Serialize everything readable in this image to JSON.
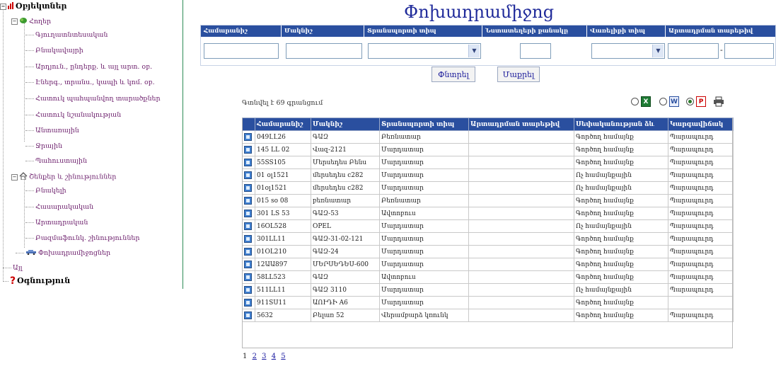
{
  "tree": {
    "root_label": "Օբյեկտներ",
    "nodes": [
      {
        "label": "Հողեր"
      },
      {
        "label": "Գյուղատնտեսական"
      },
      {
        "label": "Բնակավայրի"
      },
      {
        "label": "Արդյուն., ընդերք. և այլ արտ. օբ."
      },
      {
        "label": "Էներգ., տրանս., կապի և կոմ. օբ."
      },
      {
        "label": "Հատուկ պահպանվող տարածքներ"
      },
      {
        "label": "Հատուկ նշանակության"
      },
      {
        "label": "Անտառային"
      },
      {
        "label": "Ջրային"
      },
      {
        "label": "Պահուստային"
      },
      {
        "label": "Շենքեր և շինություններ"
      },
      {
        "label": "Բնակելի"
      },
      {
        "label": "Հասարակական"
      },
      {
        "label": "Արտադրական"
      },
      {
        "label": "Բազմաֆունկ. շինություններ"
      },
      {
        "label": "Փոխադրամիջոցներ"
      },
      {
        "label": "Այլ"
      }
    ],
    "help_label": "Օգնություն"
  },
  "title": "Փոխադրամիջոց",
  "filter": {
    "headers": [
      "Համարանիշ",
      "Մակնիշ",
      "Տրանսպորտի տիպ",
      "Նստատեղերի քանակը",
      "Վառելիքի տիպ",
      "Արտադրման տարեթիվ"
    ],
    "year_separator": "-"
  },
  "buttons": {
    "search": "Փնտրել",
    "clear": "Մաքրել"
  },
  "found_text": "Գտնվել է 69 գրանցում",
  "grid": {
    "headers": [
      "Համարանիշ",
      "Մակնիշ",
      "Տրանսպորտի տիպ",
      "Արտադրման տարեթիվ",
      "Սեփականության ձև",
      "Կարգավիճակ"
    ],
    "rows": [
      [
        "049ԼԼ26",
        "ԳԱԶ",
        "Բեռնատար",
        "",
        "Գործող համայնք",
        "Պարապուրդ"
      ],
      [
        "145 LL 02",
        "Վազ-2121",
        "Մարդատար",
        "",
        "Գործող համայնք",
        "Պարապուրդ"
      ],
      [
        "55SS105",
        "Մերսեդես Բենս",
        "Մարդատար",
        "",
        "Գործող համայնք",
        "Պարապուրդ"
      ],
      [
        "01 օլ1521",
        "մերսեդես c282",
        "Մարդատար",
        "",
        "Ոչ համայնքային",
        "Պարապուրդ"
      ],
      [
        "01օլ1521",
        "մերսեդես c282",
        "Մարդատար",
        "",
        "Ոչ համայնքային",
        "Պարապուրդ"
      ],
      [
        "015 so 08",
        "բեռնատար",
        "Բեռնատար",
        "",
        "Գործող համայնք",
        "Պարապուրդ"
      ],
      [
        "301 LS 53",
        "ԳԱԶ-53",
        "Ավտոբուս",
        "",
        "Գործող համայնք",
        "Պարապուրդ"
      ],
      [
        "16OL528",
        "OPEL",
        "Մարդատար",
        "",
        "Ոչ համայնքային",
        "Պարապուրդ"
      ],
      [
        "301LL11",
        "ԳԱԶ-31-02-121",
        "Մարդատար",
        "",
        "Գործող համայնք",
        "Պարապուրդ"
      ],
      [
        "01OL210",
        "ԳԱԶ-24",
        "Մարդատար",
        "",
        "Գործող համայնք",
        "Պարապուրդ"
      ],
      [
        "12ԱԱ897",
        "ՄԵՐՍԵԴԵՍ-600",
        "Մարդատար",
        "",
        "Գործող համայնք",
        "Պարապուրդ"
      ],
      [
        "58LL523",
        "ԳԱԶ",
        "Ավտոբուս",
        "",
        "Գործող համայնք",
        "Պարապուրդ"
      ],
      [
        "511LL11",
        "ԳԱԶ 3110",
        "Մարդատար",
        "",
        "Ոչ համայնքային",
        "Պարապուրդ"
      ],
      [
        "911SՍ11",
        "ԱՈՒԴԻ A6",
        "Մարդատար",
        "",
        "Գործող համայնք",
        ""
      ],
      [
        "5632",
        "Բելառ 52",
        "Վերամբարձ կռունկ",
        "",
        "Գործող համայնք",
        "Պարապուրդ"
      ]
    ]
  },
  "pager": {
    "current": "1",
    "pages": [
      "2",
      "3",
      "4",
      "5"
    ]
  },
  "colors": {
    "header_blue": "#2a4f9f",
    "title_blue": "#1f2a9a",
    "tree_link": "#6b1d6b",
    "tree_border": "#2e8b57"
  },
  "icons": {
    "export": [
      "excel-icon",
      "word-icon",
      "pdf-icon",
      "print-icon"
    ]
  }
}
